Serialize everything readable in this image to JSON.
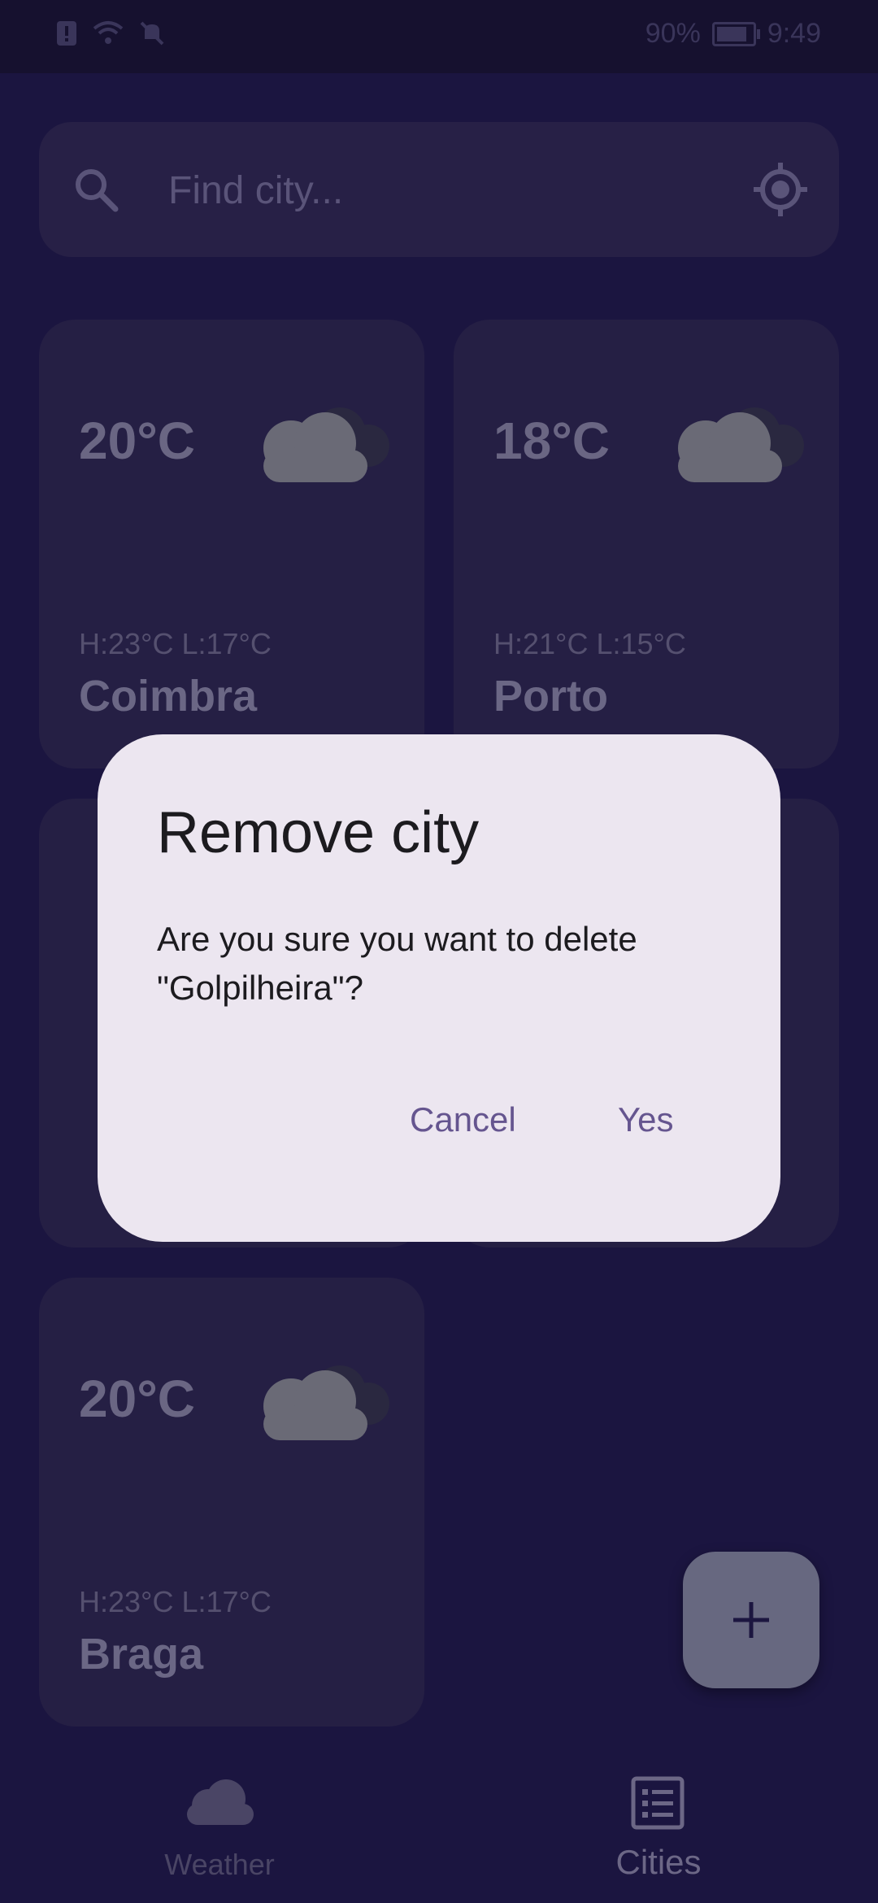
{
  "status_bar": {
    "battery": "90%",
    "time": "9:49"
  },
  "search": {
    "placeholder": "Find city..."
  },
  "cities": [
    {
      "temp": "20°C",
      "hilo": "H:23°C  L:17°C",
      "name": "Coimbra",
      "condition_icon": "cloud-icon"
    },
    {
      "temp": "18°C",
      "hilo": "H:21°C  L:15°C",
      "name": "Porto",
      "condition_icon": "cloud-icon"
    },
    {
      "temp": "20°C",
      "hilo": "H:23°C  L:17°C",
      "name": "Braga",
      "condition_icon": "cloud-icon"
    }
  ],
  "fab": {
    "icon": "plus-icon"
  },
  "bottom_nav": {
    "weather_label": "Weather",
    "cities_label": "Cities"
  },
  "dialog": {
    "title": "Remove city",
    "message": "Are you sure you want to delete \"Golpilheira\"?",
    "cancel_label": "Cancel",
    "yes_label": "Yes"
  },
  "colors": {
    "background": "#1b1540",
    "card": "#251f44",
    "dialog": "#ece6f0",
    "accent": "#65558f"
  }
}
